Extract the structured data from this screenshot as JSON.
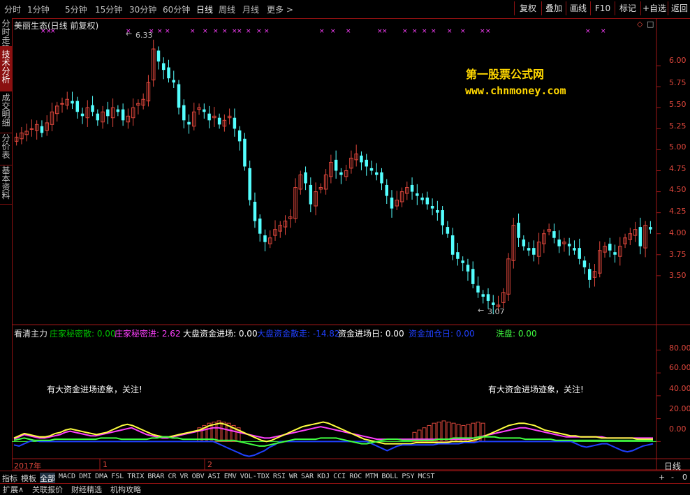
{
  "topbar": {
    "periods": [
      "分时",
      "1分钟",
      "5分钟",
      "15分钟",
      "30分钟",
      "60分钟",
      "日线",
      "周线",
      "月线",
      "更多 >"
    ],
    "active_period": "日线",
    "buttons": [
      "复权",
      "叠加",
      "画线",
      "F10",
      "标记",
      "+自选",
      "返回"
    ]
  },
  "sidebar": {
    "tabs": [
      "分时走势",
      "技术分析",
      "成交明细",
      "分价表",
      "基本资料"
    ],
    "active": "技术分析"
  },
  "main": {
    "title": "美丽生态(日线 前复权)",
    "watermark": {
      "line1": "第一股票公式网",
      "line2": "www.chnmoney.com"
    },
    "high_label": "6.33",
    "low_label": "3.07",
    "y_ticks": [
      "6.00",
      "5.75",
      "5.50",
      "5.25",
      "5.00",
      "4.75",
      "4.50",
      "4.25",
      "4.00",
      "3.75",
      "3.50"
    ],
    "ymin": 3.0,
    "ymax": 6.45,
    "marker_glyph": "××"
  },
  "indicator": {
    "name": "看清主力",
    "items": [
      {
        "label": "庄家秘密散: 0.00",
        "color": "#00c000"
      },
      {
        "label": "庄家秘密进: 2.62",
        "color": "#ff40ff"
      },
      {
        "label": "大盘资金进场: 0.00",
        "color": "#ffffff"
      },
      {
        "label": "大盘资金散走: -14.82",
        "color": "#2040ff"
      },
      {
        "label": "资金进场日: 0.00",
        "color": "#ffffff"
      },
      {
        "label": "资金加仓日: 0.00",
        "color": "#2040ff"
      },
      {
        "label": "洗盘: 0.00",
        "color": "#40ff40"
      }
    ],
    "notes": [
      "有大资金进场迹象，关注!",
      "有大资金进场迹象，关注!"
    ],
    "y_ticks": [
      "80.00",
      "60.00",
      "40.00",
      "20.00",
      "0.00"
    ],
    "ymin": -12,
    "ymax": 90
  },
  "timeaxis": {
    "year_label": "2017年",
    "marks": [
      "1",
      "2"
    ],
    "period_label": "日线"
  },
  "bottom_tabs": [
    "指标",
    "模板",
    "全部",
    "MACD",
    "DMI",
    "DMA",
    "FSL",
    "TRIX",
    "BRAR",
    "CR",
    "VR",
    "OBV",
    "ASI",
    "EMV",
    "VOL-TDX",
    "RSI",
    "WR",
    "SAR",
    "KDJ",
    "CCI",
    "ROC",
    "MTM",
    "BOLL",
    "PSY",
    "MCST"
  ],
  "bottom_active": "全部",
  "status": [
    "扩展∧",
    "关联报价",
    "财经精选",
    "机构攻略"
  ],
  "zoom_buttons": [
    "+",
    "-",
    "0"
  ],
  "chart_data": {
    "type": "candlestick",
    "title": "美丽生态(日线 前复权)",
    "close": [
      5.15,
      5.2,
      5.22,
      5.25,
      5.3,
      5.2,
      5.32,
      5.45,
      5.52,
      5.55,
      5.6,
      5.55,
      5.45,
      5.4,
      5.5,
      5.45,
      5.35,
      5.45,
      5.4,
      5.5,
      5.45,
      5.35,
      5.4,
      5.5,
      5.55,
      5.6,
      5.8,
      6.2,
      6.05,
      5.95,
      5.85,
      5.8,
      5.5,
      5.35,
      5.3,
      5.45,
      5.5,
      5.45,
      5.35,
      5.4,
      5.3,
      5.35,
      5.4,
      5.25,
      5.1,
      4.8,
      4.4,
      4.15,
      4.0,
      3.9,
      3.95,
      4.05,
      4.1,
      4.15,
      4.2,
      4.55,
      4.7,
      4.6,
      4.35,
      4.5,
      4.55,
      4.7,
      4.85,
      4.75,
      4.7,
      4.75,
      4.9,
      4.95,
      4.85,
      4.8,
      4.75,
      4.7,
      4.6,
      4.45,
      4.3,
      4.4,
      4.5,
      4.55,
      4.5,
      4.45,
      4.4,
      4.35,
      4.3,
      4.25,
      4.1,
      4.0,
      3.75,
      3.7,
      3.65,
      3.55,
      3.4,
      3.3,
      3.25,
      3.2,
      3.15,
      3.15,
      3.3,
      3.7,
      4.1,
      3.95,
      3.85,
      3.8,
      3.75,
      3.9,
      4.0,
      4.05,
      3.95,
      3.85,
      3.9,
      3.85,
      3.8,
      3.7,
      3.6,
      3.45,
      3.55,
      3.8,
      3.85,
      3.8,
      3.75,
      3.85,
      3.95,
      4.0,
      4.05,
      3.85,
      4.1,
      4.05
    ],
    "series": [
      {
        "name": "庄家秘密进",
        "color": "#ff40ff",
        "values": [
          2,
          4,
          6,
          5,
          4,
          3,
          3,
          4,
          5,
          6,
          8,
          9,
          8,
          7,
          6,
          5,
          5,
          6,
          7,
          8,
          9,
          10,
          11,
          12,
          10,
          8,
          6,
          5,
          4,
          3,
          3,
          4,
          5,
          6,
          7,
          8,
          9,
          10,
          11,
          12,
          12,
          11,
          10,
          9,
          8,
          7,
          6,
          5,
          4,
          3,
          3,
          4,
          5,
          6,
          7,
          8,
          9,
          10,
          11,
          12,
          13,
          12,
          11,
          10,
          9,
          8,
          7,
          6,
          5,
          4,
          3,
          2,
          2,
          2,
          2,
          2,
          2,
          2,
          2,
          2,
          2,
          2,
          2,
          2,
          2,
          2,
          2,
          2,
          2,
          2,
          3,
          4,
          5,
          6,
          7,
          8,
          9,
          10,
          11,
          12,
          12,
          11,
          10,
          9,
          8,
          7,
          6,
          5,
          4,
          4,
          4,
          4,
          4,
          4,
          4,
          4,
          3,
          3,
          3,
          3,
          3,
          3,
          3,
          3,
          3,
          3
        ]
      },
      {
        "name": "大盘资金进场",
        "color": "#ffff40",
        "values": [
          3,
          5,
          7,
          6,
          5,
          4,
          4,
          5,
          7,
          8,
          10,
          11,
          10,
          9,
          8,
          7,
          6,
          7,
          8,
          10,
          12,
          14,
          15,
          14,
          12,
          10,
          8,
          6,
          5,
          4,
          4,
          5,
          6,
          7,
          8,
          9,
          10,
          12,
          14,
          15,
          16,
          15,
          13,
          11,
          9,
          7,
          5,
          3,
          1,
          0,
          1,
          3,
          5,
          7,
          9,
          11,
          13,
          14,
          15,
          16,
          17,
          16,
          14,
          12,
          10,
          8,
          6,
          4,
          2,
          1,
          0,
          -1,
          -2,
          -2,
          -2,
          -2,
          -2,
          -2,
          -1,
          -1,
          -1,
          -1,
          -1,
          -1,
          -1,
          0,
          0,
          0,
          0,
          1,
          2,
          4,
          6,
          8,
          10,
          12,
          14,
          15,
          16,
          16,
          15,
          14,
          12,
          10,
          9,
          8,
          7,
          6,
          5,
          5,
          4,
          4,
          4,
          4,
          3,
          3,
          3,
          3,
          3,
          3,
          3,
          2,
          2,
          2,
          2
        ]
      },
      {
        "name": "大盘资金散走",
        "color": "#2040ff",
        "values": [
          -3,
          -4,
          -2,
          0,
          1,
          0,
          0,
          0,
          0,
          0,
          0,
          0,
          0,
          0,
          0,
          0,
          0,
          0,
          0,
          0,
          0,
          0,
          0,
          0,
          0,
          0,
          0,
          0,
          0,
          0,
          0,
          0,
          0,
          0,
          0,
          0,
          0,
          0,
          0,
          0,
          -2,
          -4,
          -6,
          -8,
          -10,
          -12,
          -13,
          -12,
          -10,
          -8,
          -5,
          -3,
          0,
          0,
          0,
          0,
          0,
          0,
          0,
          0,
          0,
          0,
          0,
          0,
          0,
          0,
          0,
          0,
          0,
          0,
          -2,
          -4,
          -6,
          -8,
          -6,
          -4,
          -3,
          -3,
          -3,
          -3,
          -3,
          -3,
          -3,
          -2,
          -2,
          -2,
          -2,
          -2,
          -1,
          -1,
          -1,
          0,
          0,
          0,
          0,
          0,
          0,
          0,
          0,
          0,
          0,
          0,
          0,
          0,
          0,
          0,
          0,
          0,
          0,
          0,
          -2,
          -4,
          -5,
          -4,
          -3,
          -2,
          -2,
          -4,
          -6,
          -8,
          -9,
          -8,
          -6,
          -4,
          -3,
          -2
        ]
      },
      {
        "name": "庄家秘密散",
        "color": "#40ff40",
        "values": [
          1,
          2,
          3,
          2,
          1,
          1,
          1,
          1,
          2,
          2,
          2,
          2,
          2,
          2,
          2,
          2,
          2,
          3,
          3,
          3,
          3,
          2,
          2,
          2,
          2,
          2,
          2,
          3,
          3,
          4,
          4,
          3,
          3,
          2,
          2,
          2,
          2,
          2,
          2,
          2,
          1,
          1,
          1,
          1,
          0,
          -1,
          -2,
          -3,
          -4,
          -4,
          -3,
          -2,
          -1,
          0,
          1,
          2,
          2,
          2,
          2,
          2,
          3,
          3,
          3,
          3,
          2,
          1,
          0,
          -1,
          -2,
          -2,
          -1,
          0,
          1,
          2,
          2,
          2,
          1,
          1,
          1,
          1,
          1,
          1,
          1,
          2,
          2,
          2,
          3,
          3,
          3,
          3,
          3,
          4,
          4,
          4,
          4,
          3,
          3,
          3,
          3,
          3,
          2,
          2,
          2,
          2,
          2,
          2,
          1,
          1,
          1,
          1,
          1,
          1,
          1,
          1,
          1,
          1,
          1,
          1,
          1,
          1,
          1,
          1,
          1,
          1,
          1,
          1
        ]
      }
    ]
  }
}
